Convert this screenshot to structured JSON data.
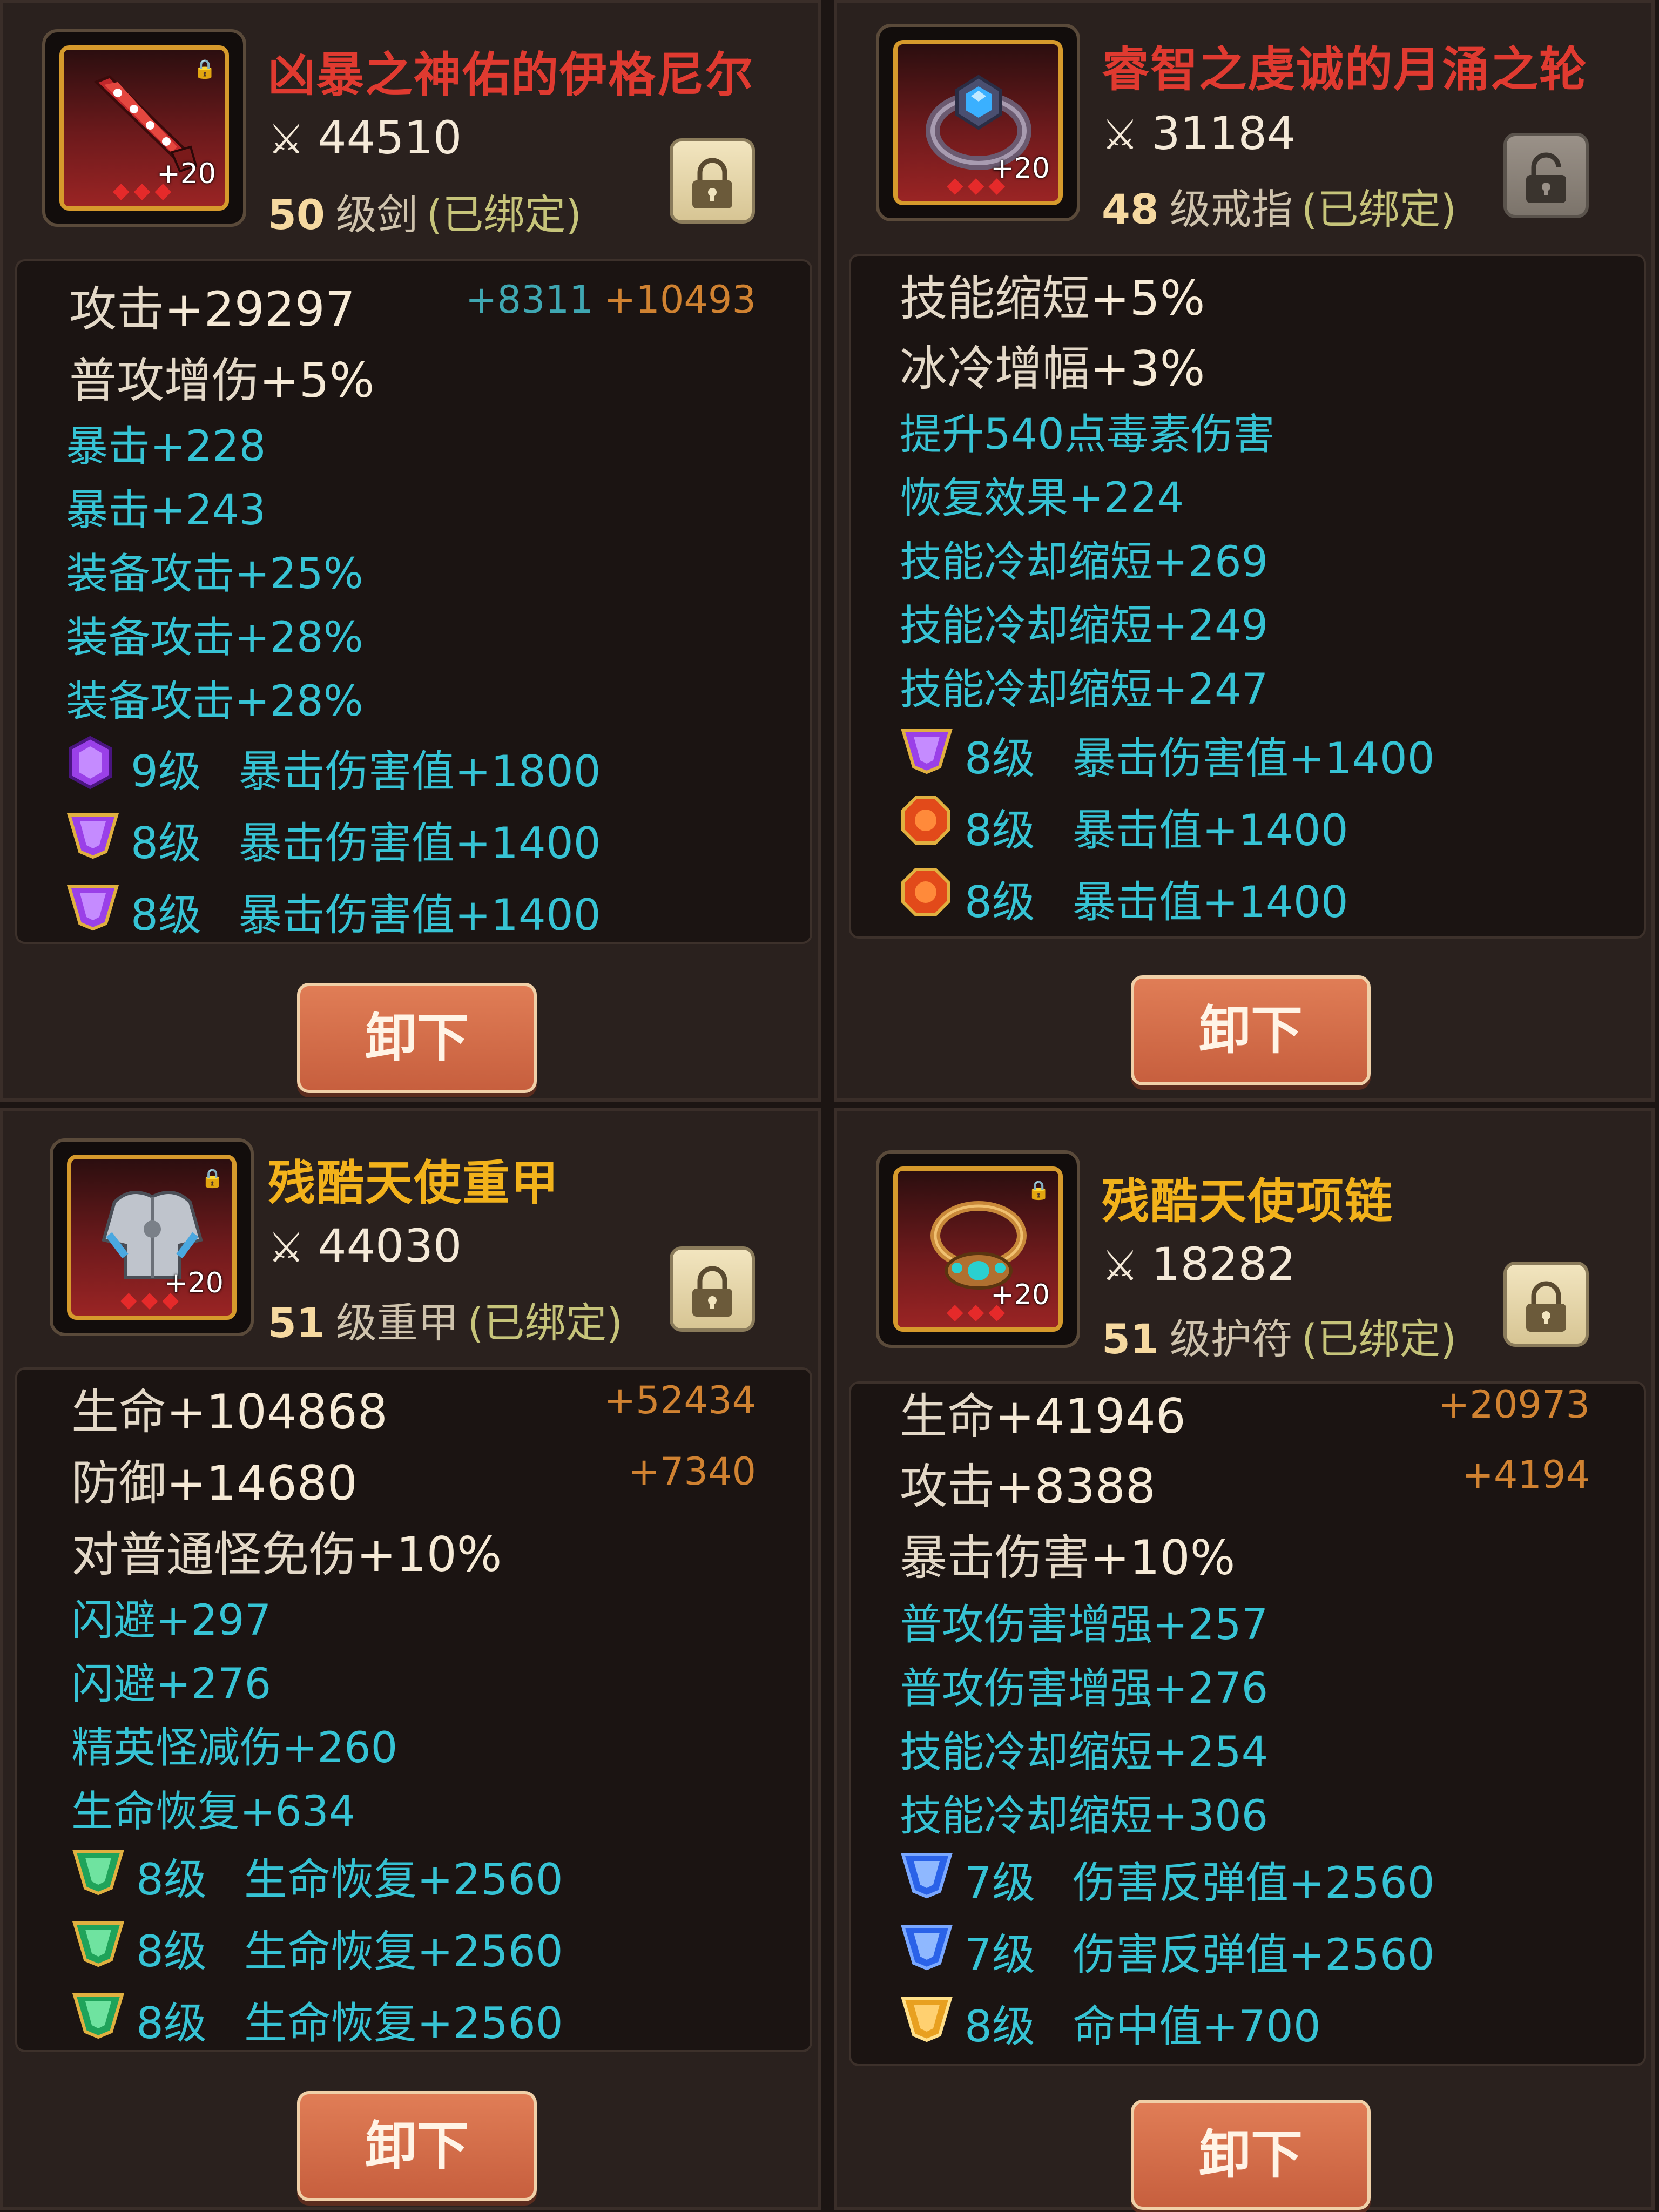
{
  "colors": {
    "red_name": "#e03a30",
    "gold_name": "#f2b21b",
    "cyan_stat": "#36c3d4",
    "orange_extra": "#d08231"
  },
  "cards": [
    {
      "name": "凶暴之神佑的伊格尼尔",
      "name_color": "#e03a30",
      "power": "44510",
      "level": "50",
      "kind": "级剑",
      "bound": "(已绑定)",
      "enhance": "+20",
      "locked": true,
      "icon": "sword-icon",
      "main_stats": [
        {
          "label": "攻击",
          "value": "+29297",
          "extra_cyan": "+8311",
          "extra_orange": "+10493"
        },
        {
          "label": "普攻增伤",
          "value": "+5%",
          "extra_cyan": "",
          "extra_orange": ""
        }
      ],
      "sub_stats": [
        "暴击+228",
        "暴击+243",
        "装备攻击+25%",
        "装备攻击+28%",
        "装备攻击+28%"
      ],
      "gems": [
        {
          "icon": "purple-hex-gem-icon",
          "level": "9级",
          "text": "暴击伤害值+1800"
        },
        {
          "icon": "purple-gem-icon",
          "level": "8级",
          "text": "暴击伤害值+1400"
        },
        {
          "icon": "purple-gem-icon",
          "level": "8级",
          "text": "暴击伤害值+1400"
        }
      ],
      "button": "卸下"
    },
    {
      "name": "睿智之虔诚的月涌之轮",
      "name_color": "#e03a30",
      "power": "31184",
      "level": "48",
      "kind": "级戒指",
      "bound": "(已绑定)",
      "enhance": "+20",
      "locked": false,
      "icon": "ring-icon",
      "main_stats": [
        {
          "label": "技能缩短",
          "value": "+5%",
          "extra_cyan": "",
          "extra_orange": ""
        },
        {
          "label": "冰冷增幅",
          "value": "+3%",
          "extra_cyan": "",
          "extra_orange": ""
        }
      ],
      "sub_stats": [
        "提升540点毒素伤害",
        "恢复效果+224",
        "技能冷却缩短+269",
        "技能冷却缩短+249",
        "技能冷却缩短+247"
      ],
      "gems": [
        {
          "icon": "purple-gem-icon",
          "level": "8级",
          "text": "暴击伤害值+1400"
        },
        {
          "icon": "orange-round-gem-icon",
          "level": "8级",
          "text": "暴击值+1400"
        },
        {
          "icon": "orange-round-gem-icon",
          "level": "8级",
          "text": "暴击值+1400"
        }
      ],
      "button": "卸下"
    },
    {
      "name": "残酷天使重甲",
      "name_color": "#f2b21b",
      "power": "44030",
      "level": "51",
      "kind": "级重甲",
      "bound": "(已绑定)",
      "enhance": "+20",
      "locked": true,
      "icon": "armor-icon",
      "main_stats": [
        {
          "label": "生命",
          "value": "+104868",
          "extra_cyan": "",
          "extra_orange": "+52434"
        },
        {
          "label": "防御",
          "value": "+14680",
          "extra_cyan": "",
          "extra_orange": "+7340"
        },
        {
          "label": "对普通怪免伤",
          "value": "+10%",
          "extra_cyan": "",
          "extra_orange": ""
        }
      ],
      "sub_stats": [
        "闪避+297",
        "闪避+276",
        "精英怪减伤+260",
        "生命恢复+634"
      ],
      "gems": [
        {
          "icon": "green-gem-icon",
          "level": "8级",
          "text": "生命恢复+2560"
        },
        {
          "icon": "green-gem-icon",
          "level": "8级",
          "text": "生命恢复+2560"
        },
        {
          "icon": "green-gem-icon",
          "level": "8级",
          "text": "生命恢复+2560"
        }
      ],
      "button": "卸下"
    },
    {
      "name": "残酷天使项链",
      "name_color": "#f2b21b",
      "power": "18282",
      "level": "51",
      "kind": "级护符",
      "bound": "(已绑定)",
      "enhance": "+20",
      "locked": true,
      "icon": "necklace-icon",
      "main_stats": [
        {
          "label": "生命",
          "value": "+41946",
          "extra_cyan": "",
          "extra_orange": "+20973"
        },
        {
          "label": "攻击",
          "value": "+8388",
          "extra_cyan": "",
          "extra_orange": "+4194"
        },
        {
          "label": "暴击伤害",
          "value": "+10%",
          "extra_cyan": "",
          "extra_orange": ""
        }
      ],
      "sub_stats": [
        "普攻伤害增强+257",
        "普攻伤害增强+276",
        "技能冷却缩短+254",
        "技能冷却缩短+306"
      ],
      "gems": [
        {
          "icon": "blue-gem-icon",
          "level": "7级",
          "text": "伤害反弹值+2560"
        },
        {
          "icon": "blue-gem-icon",
          "level": "7级",
          "text": "伤害反弹值+2560"
        },
        {
          "icon": "yellow-gem-icon",
          "level": "8级",
          "text": "命中值+700"
        }
      ],
      "button": "卸下"
    }
  ]
}
